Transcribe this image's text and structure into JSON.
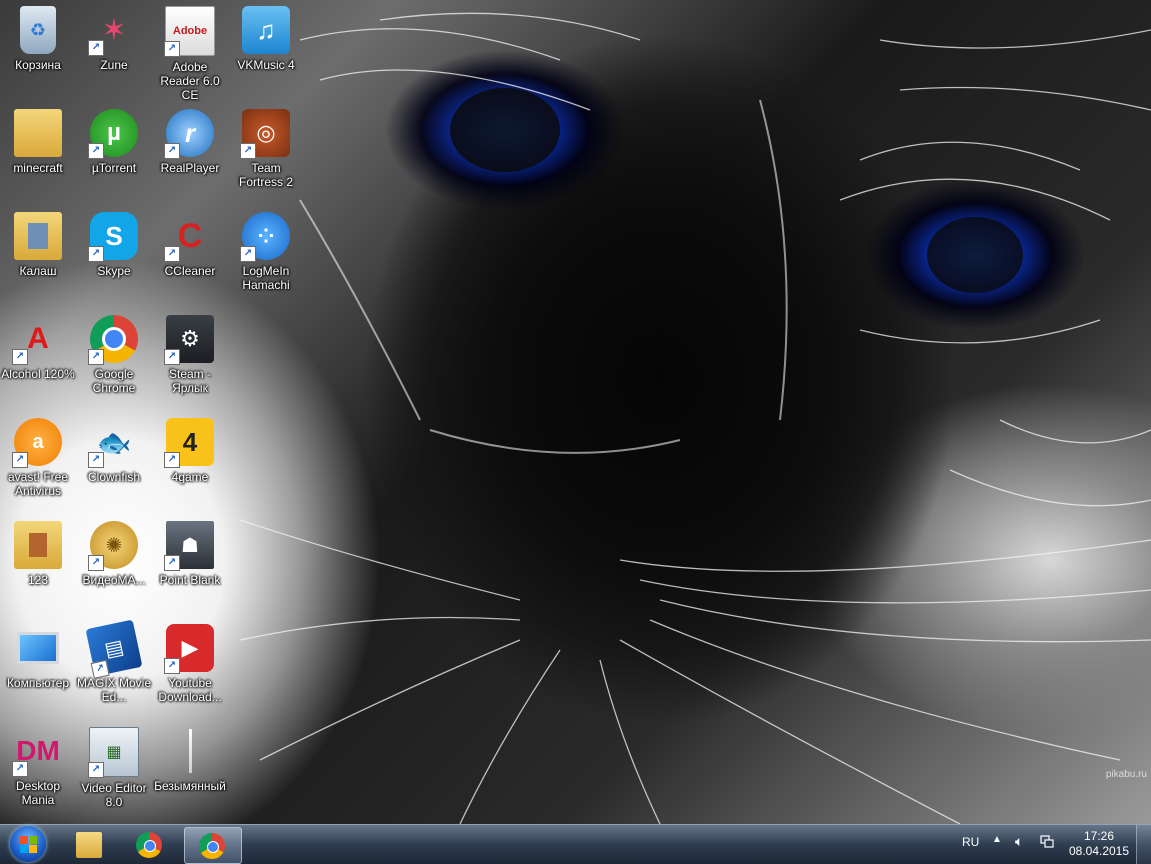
{
  "desktop": {
    "icons": [
      {
        "id": "recycle-bin",
        "label": "Корзина",
        "shortcut": false
      },
      {
        "id": "zune",
        "label": "Zune",
        "shortcut": true
      },
      {
        "id": "adobe-reader",
        "label": "Adobe Reader 6.0 CE",
        "shortcut": true
      },
      {
        "id": "vkmusic",
        "label": "VKMusic 4",
        "shortcut": false
      },
      {
        "id": "minecraft",
        "label": "minecraft",
        "shortcut": false
      },
      {
        "id": "utorrent",
        "label": "µTorrent",
        "shortcut": true
      },
      {
        "id": "realplayer",
        "label": "RealPlayer",
        "shortcut": true
      },
      {
        "id": "team-fortress",
        "label": "Team Fortress 2",
        "shortcut": true
      },
      {
        "id": "kalash",
        "label": "Калаш",
        "shortcut": false
      },
      {
        "id": "skype",
        "label": "Skype",
        "shortcut": true
      },
      {
        "id": "ccleaner",
        "label": "CCleaner",
        "shortcut": true
      },
      {
        "id": "hamachi",
        "label": "LogMeIn Hamachi",
        "shortcut": true
      },
      {
        "id": "alcohol",
        "label": "Alcohol 120%",
        "shortcut": true
      },
      {
        "id": "google-chrome",
        "label": "Google Chrome",
        "shortcut": true
      },
      {
        "id": "steam",
        "label": "Steam - Ярлык",
        "shortcut": true
      },
      {
        "id": "avast",
        "label": "avast! Free Antivirus",
        "shortcut": true
      },
      {
        "id": "clownfish",
        "label": "Clownfish",
        "shortcut": true
      },
      {
        "id": "4game",
        "label": "4game",
        "shortcut": true
      },
      {
        "id": "folder-123",
        "label": "123",
        "shortcut": false
      },
      {
        "id": "videomaster",
        "label": "ВидеоМА...",
        "shortcut": true
      },
      {
        "id": "point-blank",
        "label": "Point Blank",
        "shortcut": true
      },
      {
        "id": "computer",
        "label": "Компьютер",
        "shortcut": false
      },
      {
        "id": "magix",
        "label": "MAGIX Movie Ed...",
        "shortcut": true
      },
      {
        "id": "youtube-downloader",
        "label": "Youtube Download...",
        "shortcut": true
      },
      {
        "id": "desktop-mania",
        "label": "Desktop Mania",
        "shortcut": true
      },
      {
        "id": "video-editor",
        "label": "Video Editor 8.0",
        "shortcut": true
      },
      {
        "id": "untitled",
        "label": "Безымянный",
        "shortcut": false
      }
    ],
    "watermark": "pikabu.ru"
  },
  "taskbar": {
    "pinned": [
      {
        "name": "windows-explorer",
        "active": false
      },
      {
        "name": "google-chrome",
        "active": false
      },
      {
        "name": "google-chrome-window",
        "active": true
      }
    ],
    "tray": {
      "language": "RU",
      "time": "17:26",
      "date": "08.04.2015"
    }
  },
  "colors": {
    "taskbar": "#2a3a50",
    "eye_blue": "#1a6bff",
    "label_text": "#ffffff"
  }
}
